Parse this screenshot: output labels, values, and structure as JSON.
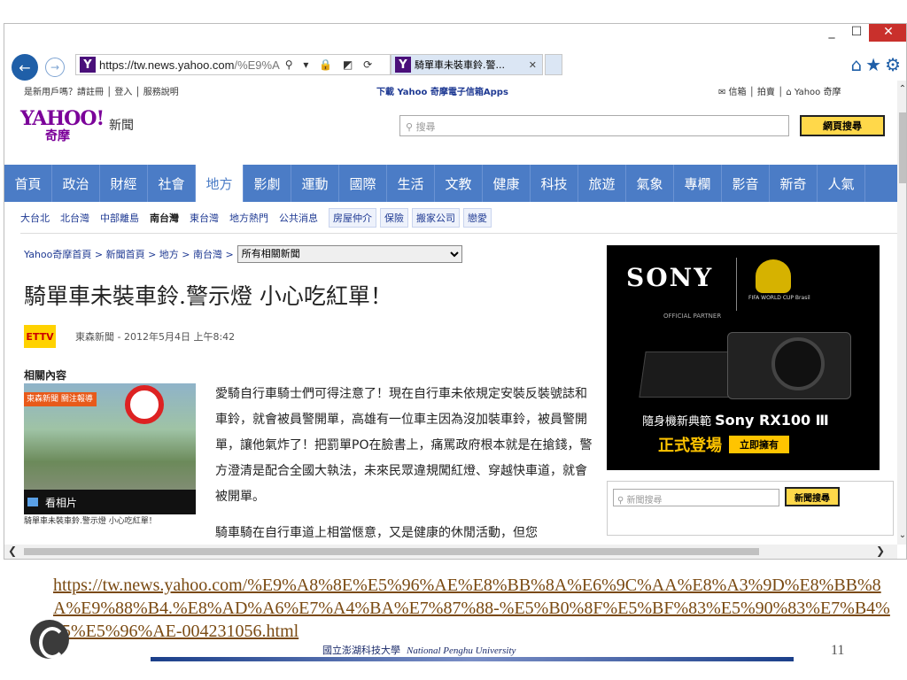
{
  "browser": {
    "address": "https://tw.news.yahoo.com",
    "address_dim": "/%E9%A",
    "address_icons": "⚲ ▾ 🔒 ◩ ⟳",
    "tab_title": "騎單車未裝車鈴.警...",
    "window_controls": [
      "_",
      "☐",
      "✕"
    ],
    "right_tools": "⌂★⚙"
  },
  "page": {
    "topbar": {
      "left": "是新用戶嗎？請註冊 │ 登入 │ 服務說明",
      "mid": "下載 Yahoo 奇摩電子信箱Apps",
      "right": "✉ 信箱 │ 拍賣 │ ⌂ Yahoo 奇摩"
    },
    "logo": {
      "main": "YAHOO!",
      "sub": "奇摩",
      "section": "新聞"
    },
    "search_placeholder": "搜尋",
    "search_button": "網頁搜尋",
    "mainnav": [
      "首頁",
      "政治",
      "財經",
      "社會",
      "地方",
      "影劇",
      "運動",
      "國際",
      "生活",
      "文教",
      "健康",
      "科技",
      "旅遊",
      "氣象",
      "專欄",
      "影音",
      "新奇",
      "人氣"
    ],
    "mainnav_active": "地方",
    "subnav": [
      {
        "label": "大台北",
        "style": ""
      },
      {
        "label": "北台灣",
        "style": ""
      },
      {
        "label": "中部離島",
        "style": ""
      },
      {
        "label": "南台灣",
        "style": "bold"
      },
      {
        "label": "東台灣",
        "style": ""
      },
      {
        "label": "地方熱門",
        "style": ""
      },
      {
        "label": "公共消息",
        "style": ""
      },
      {
        "label": "房屋仲介",
        "style": "box"
      },
      {
        "label": "保險",
        "style": "box"
      },
      {
        "label": "搬家公司",
        "style": "box"
      },
      {
        "label": "戀愛",
        "style": "box"
      }
    ],
    "breadcrumb": "Yahoo奇摩首頁 > 新聞首頁 > 地方 > 南台灣 >",
    "breadcrumb_select": "所有相關新聞",
    "headline": "騎單車未裝車鈴.警示燈 小心吃紅單！",
    "source_logo": "ETTV",
    "source": "東森新聞 - 2012年5月4日 上午8:42",
    "related": "相關內容",
    "thumb_bar": "東森新聞 關注報導",
    "thumb_watch": "看相片",
    "thumb_caption": "騎單車未裝車鈴.警示燈 小心吃紅單！",
    "paragraph1": "愛騎自行車騎士們可得注意了！現在自行車未依規定安裝反裝號誌和車鈴，就會被員警開單，高雄有一位車主因為沒加裝車鈴，被員警開單，讓他氣炸了！把罰單PO在臉書上，痛罵政府根本就是在搶錢，警方澄清是配合全國大執法，未來民眾違規闖紅燈、穿越快車道，就會被開單。",
    "paragraph2": "騎車騎在自行車道上相當愜意，又是健康的休閒活動，但您",
    "ad": {
      "brand": "SONY",
      "fifa": "FIFA WORLD CUP Brasil",
      "partner": "OFFICIAL PARTNER",
      "line1_a": "隨身機新典範 ",
      "line1_b": "Sony RX100 Ⅲ",
      "line2": "正式登場",
      "buy": "立即擁有"
    },
    "news_search_placeholder": "新聞搜尋",
    "news_search_button": "新聞搜尋"
  },
  "slide": {
    "link": "https://tw.news.yahoo.com/%E9%A8%8E%E5%96%AE%E8%BB%8A%E6%9C%AA%E8%A3%9D%E8%BB%8A%E9%88%B4.%E8%AD%A6%E7%A4%BA%E7%87%88-%E5%B0%8F%E5%BF%83%E5%90%83%E7%B4%85%E5%96%AE-004231056.html",
    "university_cn": "國立澎湖科技大學",
    "university_en": "National Penghu University",
    "page_number": "11"
  }
}
